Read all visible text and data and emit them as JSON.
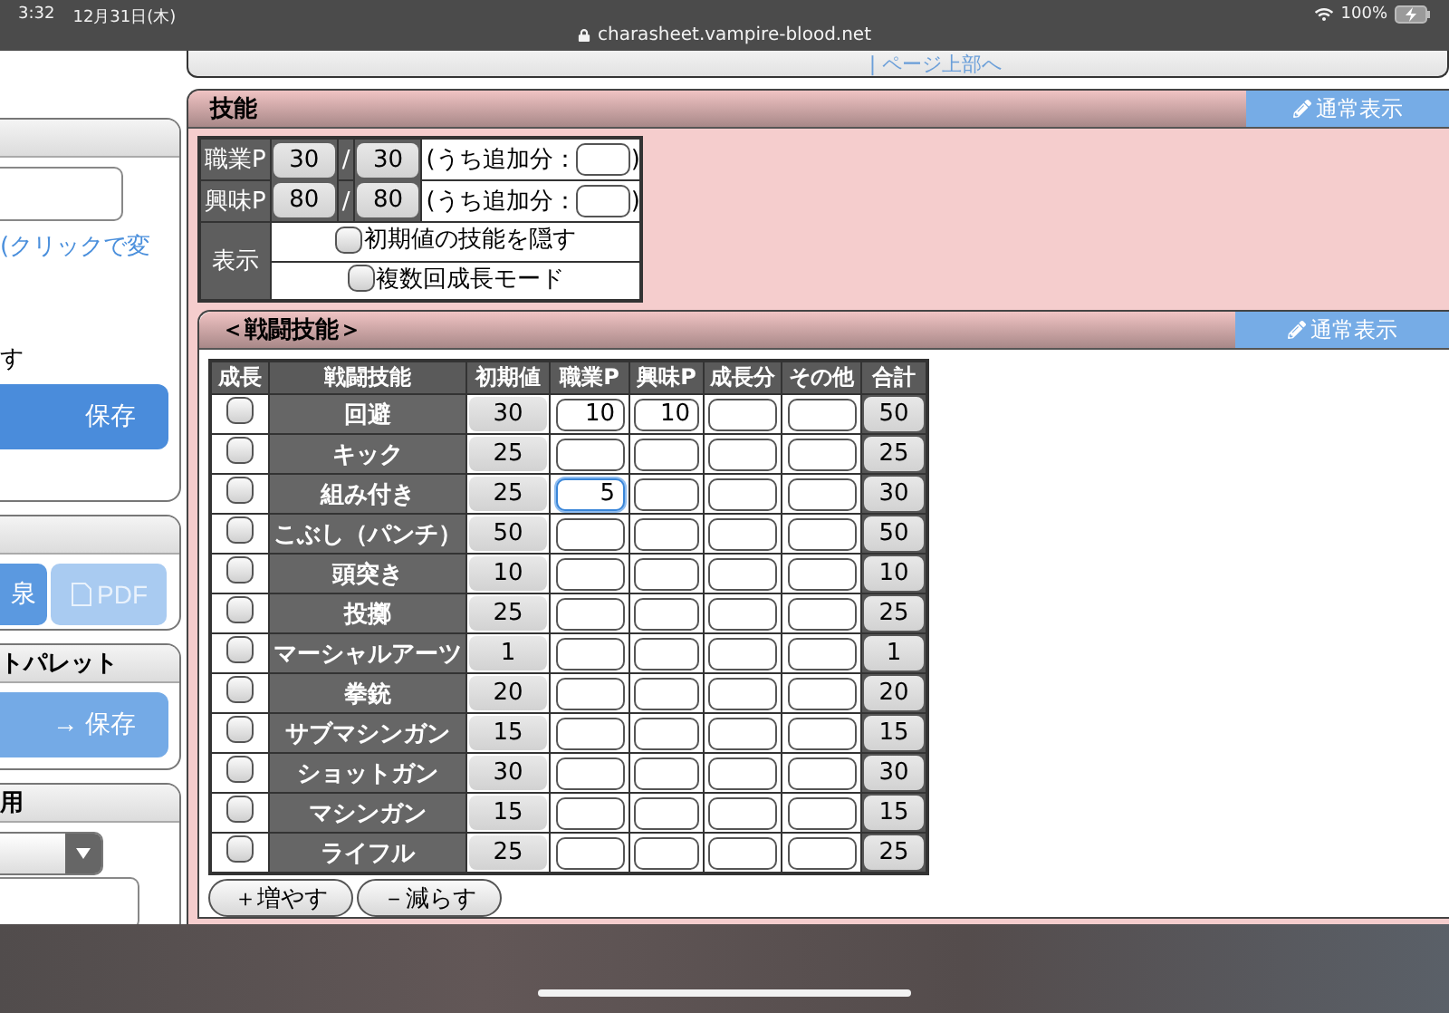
{
  "status_bar": {
    "time": "3:32",
    "date": "12月31日(木)",
    "url": "charasheet.vampire-blood.net",
    "battery": "100%"
  },
  "top_link": "| ページ上部へ",
  "sidebar": {
    "profile": {
      "link": "(クリックで変",
      "hide_text": "す",
      "save_button": "保存"
    },
    "output": {
      "buttons": [
        {
          "label": "泉",
          "kind": "primary"
        },
        {
          "label": "PDF",
          "kind": "pdf"
        }
      ]
    },
    "palette": {
      "title": "トパレット",
      "button": "→ 保存"
    },
    "usage": {
      "title": "用"
    }
  },
  "skills_panel": {
    "title": "技能",
    "mode_button": "通常表示",
    "points": [
      {
        "label": "職業P",
        "current": "30",
        "slash": "/",
        "max": "30",
        "extra_open": "(うち追加分：",
        "extra_close": ")"
      },
      {
        "label": "興味P",
        "current": "80",
        "slash": "/",
        "max": "80",
        "extra_open": "(うち追加分：",
        "extra_close": ")"
      }
    ],
    "display": {
      "label": "表示",
      "options": [
        {
          "label": "初期値の技能を隠す",
          "checked": false
        },
        {
          "label": "複数回成長モード",
          "checked": false
        }
      ]
    },
    "combat": {
      "title": "＜戦闘技能＞",
      "mode_button": "通常表示",
      "columns": [
        "成長",
        "戦闘技能",
        "初期値",
        "職業P",
        "興味P",
        "成長分",
        "その他",
        "合計"
      ],
      "rows": [
        {
          "grow": false,
          "name": "回避",
          "initial": "30",
          "job": "10",
          "interest": "10",
          "total": "50",
          "job_focused": false
        },
        {
          "grow": false,
          "name": "キック",
          "initial": "25",
          "total": "25",
          "job_focused": false
        },
        {
          "grow": false,
          "name": "組み付き",
          "initial": "25",
          "job": "5",
          "total": "30",
          "job_focused": true
        },
        {
          "grow": false,
          "name": "こぶし（パンチ）",
          "initial": "50",
          "total": "50",
          "job_focused": false
        },
        {
          "grow": false,
          "name": "頭突き",
          "initial": "10",
          "total": "10",
          "job_focused": false
        },
        {
          "grow": false,
          "name": "投擲",
          "initial": "25",
          "total": "25",
          "job_focused": false
        },
        {
          "grow": false,
          "name": "マーシャルアーツ",
          "initial": "1",
          "total": "1",
          "job_focused": false
        },
        {
          "grow": false,
          "name": "拳銃",
          "initial": "20",
          "total": "20",
          "job_focused": false
        },
        {
          "grow": false,
          "name": "サブマシンガン",
          "initial": "15",
          "total": "15",
          "job_focused": false
        },
        {
          "grow": false,
          "name": "ショットガン",
          "initial": "30",
          "total": "30",
          "job_focused": false
        },
        {
          "grow": false,
          "name": "マシンガン",
          "initial": "15",
          "total": "15",
          "job_focused": false
        },
        {
          "grow": false,
          "name": "ライフル",
          "initial": "25",
          "total": "25",
          "job_focused": false
        }
      ],
      "buttons": [
        "＋増やす",
        "－減らす"
      ]
    }
  }
}
